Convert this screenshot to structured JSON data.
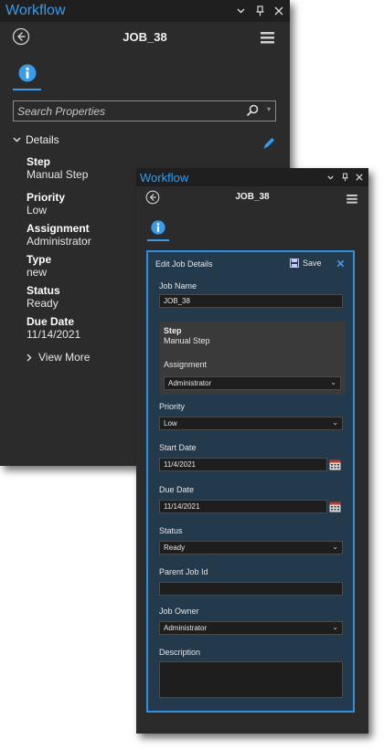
{
  "back_panel": {
    "window_title": "Workflow",
    "job_title": "JOB_38",
    "search_placeholder": "Search Properties",
    "details_label": "Details",
    "fields": [
      {
        "label": "Step",
        "value": "Manual Step"
      },
      {
        "label": "Priority",
        "value": "Low"
      },
      {
        "label": "Assignment",
        "value": "Administrator"
      },
      {
        "label": "Type",
        "value": "new"
      },
      {
        "label": "Status",
        "value": "Ready"
      },
      {
        "label": "Due Date",
        "value": "11/14/2021"
      }
    ],
    "view_more": "View More"
  },
  "front_panel": {
    "window_title": "Workflow",
    "job_title": "JOB_38",
    "form_title": "Edit Job Details",
    "save_label": "Save",
    "job_name_label": "Job Name",
    "job_name_value": "JOB_38",
    "step_label": "Step",
    "step_value": "Manual Step",
    "assignment_label": "Assignment",
    "assignment_value": "Administrator",
    "priority_label": "Priority",
    "priority_value": "Low",
    "start_date_label": "Start Date",
    "start_date_value": "11/4/2021",
    "due_date_label": "Due Date",
    "due_date_value": "11/14/2021",
    "status_label": "Status",
    "status_value": "Ready",
    "parent_job_label": "Parent Job Id",
    "parent_job_value": "",
    "job_owner_label": "Job Owner",
    "job_owner_value": "Administrator",
    "description_label": "Description",
    "description_value": ""
  },
  "colors": {
    "accent": "#3a9ce8",
    "panel_bg": "#2b2b2b",
    "form_bg": "#233a4d",
    "form_border": "#2f8fe0"
  },
  "icons": [
    "back-arrow-icon",
    "hamburger-menu-icon",
    "info-icon",
    "search-icon",
    "pencil-icon",
    "save-icon",
    "close-icon",
    "calendar-icon",
    "chevron-down-icon",
    "pin-icon"
  ]
}
